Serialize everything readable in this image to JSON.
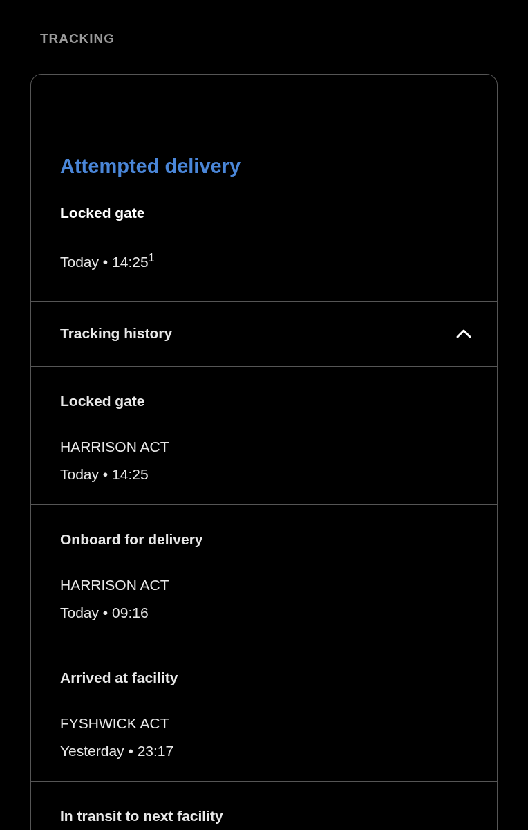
{
  "section_heading": "TRACKING",
  "status": {
    "title": "Attempted delivery",
    "reason": "Locked gate",
    "time": "Today • 14:25$^{1}$"
  },
  "history": {
    "label": "Tracking history",
    "expanded": true,
    "events": [
      {
        "title": "Locked gate",
        "location": "HARRISON ACT",
        "time": "Today • 14:25"
      },
      {
        "title": "Onboard for delivery",
        "location": "HARRISON ACT",
        "time": "Today • 09:16"
      },
      {
        "title": "Arrived at facility",
        "location": "FYSHWICK ACT",
        "time": "Yesterday • 23:17"
      },
      {
        "title": "In transit to next facility"
      }
    ]
  }
}
